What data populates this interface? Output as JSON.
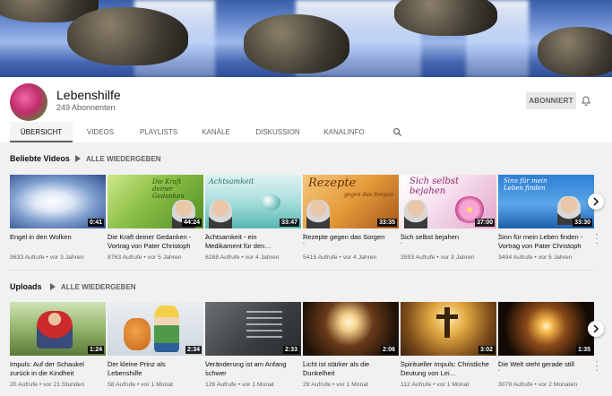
{
  "channel": {
    "name": "Lebenshilfe",
    "subscribers": "249 Abonnenten",
    "subscribe_label": "ABONNIERT"
  },
  "tabs": [
    {
      "label": "ÜBERSICHT",
      "active": true
    },
    {
      "label": "VIDEOS",
      "active": false
    },
    {
      "label": "PLAYLISTS",
      "active": false
    },
    {
      "label": "KANÄLE",
      "active": false
    },
    {
      "label": "DISKUSSION",
      "active": false
    },
    {
      "label": "KANALINFO",
      "active": false
    }
  ],
  "icons": {
    "search": "search-icon",
    "bell": "bell-icon",
    "next": "chevron-right-icon"
  },
  "popular": {
    "title": "Beliebte Videos",
    "play_all": "ALLE WIEDERGEBEN",
    "videos": [
      {
        "title": "Engel in den Wolken",
        "meta": "9633 Aufrufe • vor 3 Jahren",
        "duration": "0:41"
      },
      {
        "title": "Die Kraft deiner Gedanken - Vortrag von Pater Christoph",
        "meta": "8763 Aufrufe • vor 5 Jahren",
        "duration": "44:24"
      },
      {
        "title": "Achtsamkeit - ein Medikament für den…",
        "meta": "6288 Aufrufe • vor 4 Jahren",
        "duration": "33:47"
      },
      {
        "title": "Rezepte gegen das Sorgen",
        "meta": "5415 Aufrufe • vor 4 Jahren",
        "duration": "33:35"
      },
      {
        "title": "Sich selbst bejahen",
        "meta": "3593 Aufrufe • vor 3 Jahren",
        "duration": "37:00"
      },
      {
        "title": "Sinn für mein Leben finden - Vortrag von Pater Christoph",
        "meta": "3494 Aufrufe • vor 5 Jahren",
        "duration": "33:30"
      }
    ],
    "thumb_texts": [
      "Die Kraft deiner Gedanken",
      "Achtsamkeit",
      "Rezepte",
      "gegen das Sorgen",
      "Sich selbst bejahen",
      "Sinn für mein Leben finden"
    ]
  },
  "uploads": {
    "title": "Uploads",
    "play_all": "ALLE WIEDERGEBEN",
    "videos": [
      {
        "title": "Impuls: Auf der Schaukel zurück in die Kindheit",
        "meta": "20 Aufrufe • vor 21 Stunden",
        "duration": "1:24"
      },
      {
        "title": "Der kleine Prinz als Lebenshilfe",
        "meta": "58 Aufrufe • vor 1 Monat",
        "duration": "2:34"
      },
      {
        "title": "Veränderung ist am Anfang schwer",
        "meta": "126 Aufrufe • vor 1 Monat",
        "duration": "2:33"
      },
      {
        "title": "Licht ist stärker als die Dunkelheit",
        "meta": "29 Aufrufe • vor 1 Monat",
        "duration": "2:06"
      },
      {
        "title": "Spiritueller Impuls: Christliche Deutung von Lei…",
        "meta": "112 Aufrufe • vor 1 Monat",
        "duration": "3:02"
      },
      {
        "title": "Die Welt steht gerade still",
        "meta": "3079 Aufrufe • vor 2 Monaten",
        "duration": "1:35"
      }
    ]
  }
}
